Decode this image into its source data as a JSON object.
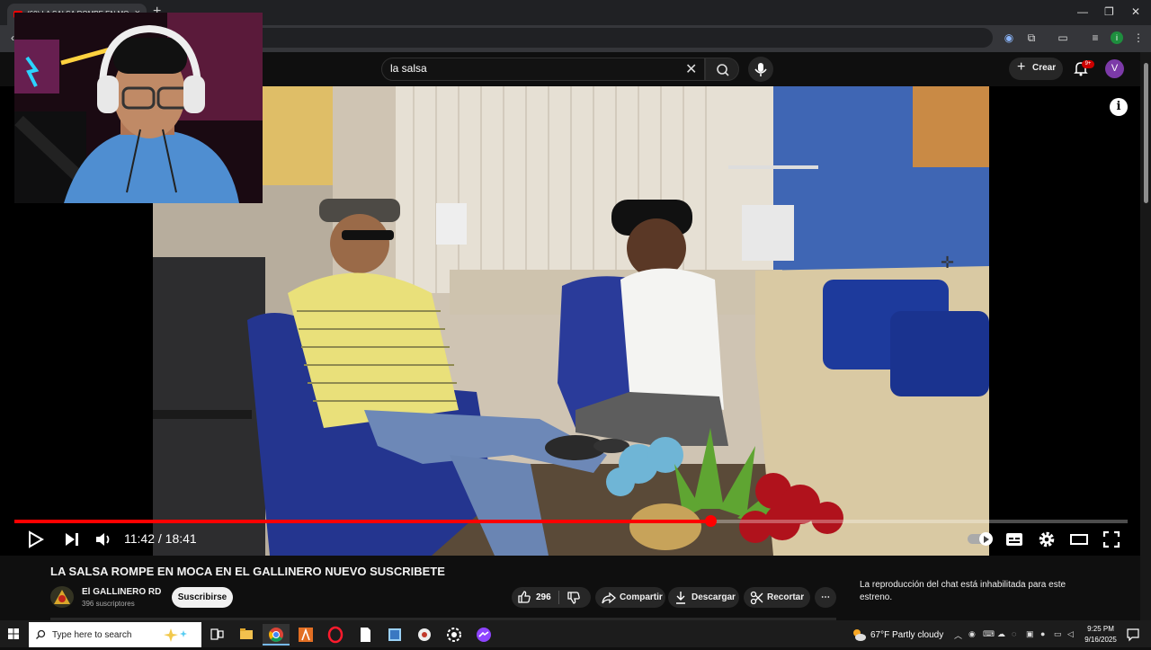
{
  "browser": {
    "tab_title": "(60) LA SALSA ROMPE EN MO...",
    "tab_close": "×",
    "new_tab": "+",
    "window_buttons": {
      "minimize": "—",
      "restore": "❐",
      "close": "✕"
    },
    "extension_avatar": "i"
  },
  "youtube_header": {
    "search_value": "la salsa",
    "create_label": "Crear",
    "notifications_badge": "9+",
    "account_initial": "V"
  },
  "player": {
    "current_time": "11:42",
    "duration": "18:41",
    "time_display": "11:42 / 18:41",
    "progress_fraction": 0.625,
    "accent_color": "#ff0000"
  },
  "video": {
    "title": "LA SALSA ROMPE EN MOCA EN EL GALLINERO NUEVO SUSCRIBETE",
    "channel_name": "El GALLINERO RD",
    "subscribers": "396 suscriptores",
    "subscribe_label": "Suscribirse",
    "like_count": "296",
    "share_label": "Compartir",
    "download_label": "Descargar",
    "clip_label": "Recortar",
    "more_label": "⋯"
  },
  "chat": {
    "message": "La reproducción del chat está inhabilitada para este estreno."
  },
  "taskbar": {
    "search_placeholder": "Type here to search",
    "weather_temp": "67°F",
    "weather_desc": "Partly cloudy",
    "time": "9:25 PM",
    "date": "9/16/2025"
  },
  "icons": [
    "youtube-favicon-icon",
    "back-arrow-icon",
    "cast-icon",
    "extensions-icon",
    "media-icon",
    "menu-dots-icon",
    "search-icon",
    "close-icon",
    "mic-icon",
    "plus-icon",
    "bell-icon",
    "info-icon",
    "play-icon",
    "next-icon",
    "volume-icon",
    "autoplay-toggle",
    "subtitles-icon",
    "settings-icon",
    "theater-icon",
    "fullscreen-icon",
    "like-icon",
    "dislike-icon",
    "share-icon",
    "download-icon",
    "scissors-icon",
    "windows-start-icon",
    "task-view-icon"
  ]
}
